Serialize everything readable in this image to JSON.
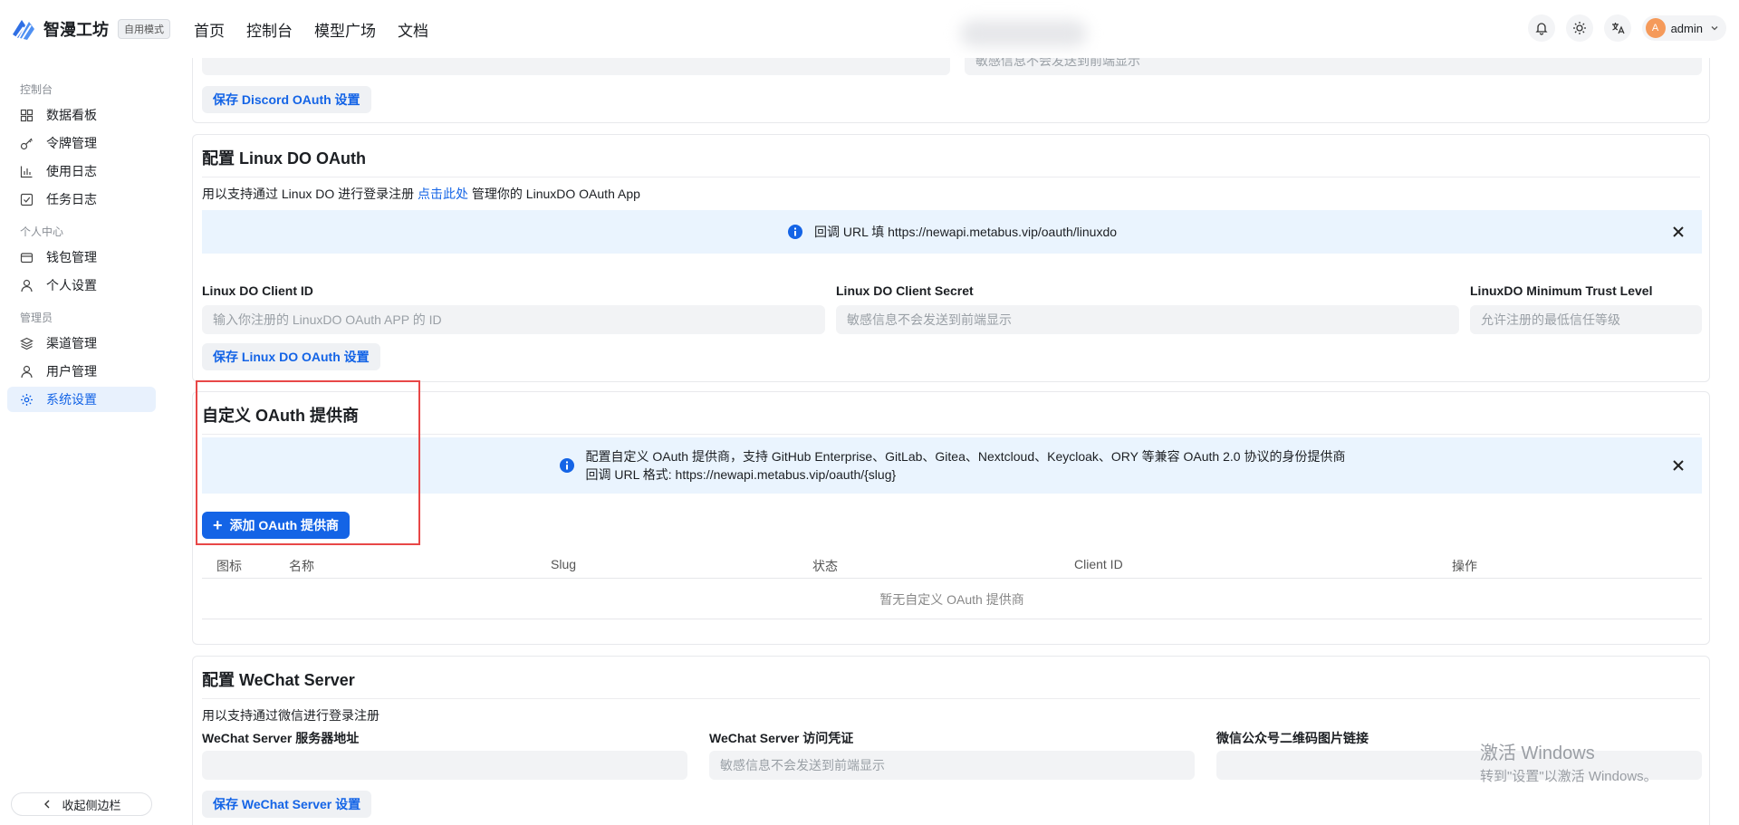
{
  "app": {
    "name": "智漫工坊",
    "mode_badge": "自用模式",
    "nav": [
      "首页",
      "控制台",
      "模型广场",
      "文档"
    ],
    "user": {
      "avatar_letter": "A",
      "name": "admin"
    }
  },
  "sidebar": {
    "groups": [
      {
        "title": "控制台",
        "items": [
          {
            "label": "数据看板",
            "icon": "dashboard-icon"
          },
          {
            "label": "令牌管理",
            "icon": "key-icon"
          },
          {
            "label": "使用日志",
            "icon": "chart-icon"
          },
          {
            "label": "任务日志",
            "icon": "task-icon"
          }
        ]
      },
      {
        "title": "个人中心",
        "items": [
          {
            "label": "钱包管理",
            "icon": "wallet-icon"
          },
          {
            "label": "个人设置",
            "icon": "user-icon"
          }
        ]
      },
      {
        "title": "管理员",
        "items": [
          {
            "label": "渠道管理",
            "icon": "layers-icon"
          },
          {
            "label": "用户管理",
            "icon": "user-icon"
          },
          {
            "label": "系统设置",
            "icon": "gear-icon",
            "active": true
          }
        ]
      }
    ],
    "collapse_label": "收起侧边栏"
  },
  "discord": {
    "secret_placeholder": "敏感信息不会发送到前端显示",
    "save_label": "保存 Discord OAuth 设置"
  },
  "linuxdo": {
    "title": "配置 Linux DO OAuth",
    "desc_prefix": "用以支持通过 Linux DO 进行登录注册",
    "desc_link": "点击此处",
    "desc_suffix": "管理你的 LinuxDO OAuth App",
    "banner": "回调 URL 填 https://newapi.metabus.vip/oauth/linuxdo",
    "fields": [
      {
        "label": "Linux DO Client ID",
        "placeholder": "输入你注册的 LinuxDO OAuth APP 的 ID"
      },
      {
        "label": "Linux DO Client Secret",
        "placeholder": "敏感信息不会发送到前端显示"
      },
      {
        "label": "LinuxDO Minimum Trust Level",
        "placeholder": "允许注册的最低信任等级"
      }
    ],
    "save_label": "保存 Linux DO OAuth 设置"
  },
  "custom_oauth": {
    "title": "自定义 OAuth 提供商",
    "banner_line1": "配置自定义 OAuth 提供商，支持 GitHub Enterprise、GitLab、Gitea、Nextcloud、Keycloak、ORY 等兼容 OAuth 2.0 协议的身份提供商",
    "banner_line2": "回调 URL 格式: https://newapi.metabus.vip/oauth/{slug}",
    "add_label": "添加 OAuth 提供商",
    "columns": [
      "图标",
      "名称",
      "Slug",
      "状态",
      "Client ID",
      "操作"
    ],
    "empty_text": "暂无自定义 OAuth 提供商"
  },
  "wechat": {
    "title": "配置 WeChat Server",
    "desc": "用以支持通过微信进行登录注册",
    "fields": [
      {
        "label": "WeChat Server 服务器地址",
        "placeholder": ""
      },
      {
        "label": "WeChat Server 访问凭证",
        "placeholder": "敏感信息不会发送到前端显示"
      },
      {
        "label": "微信公众号二维码图片链接",
        "placeholder": ""
      }
    ],
    "save_label": "保存 WeChat Server 设置"
  },
  "watermark": {
    "line1": "激活 Windows",
    "line2": "转到\"设置\"以激活 Windows。"
  }
}
